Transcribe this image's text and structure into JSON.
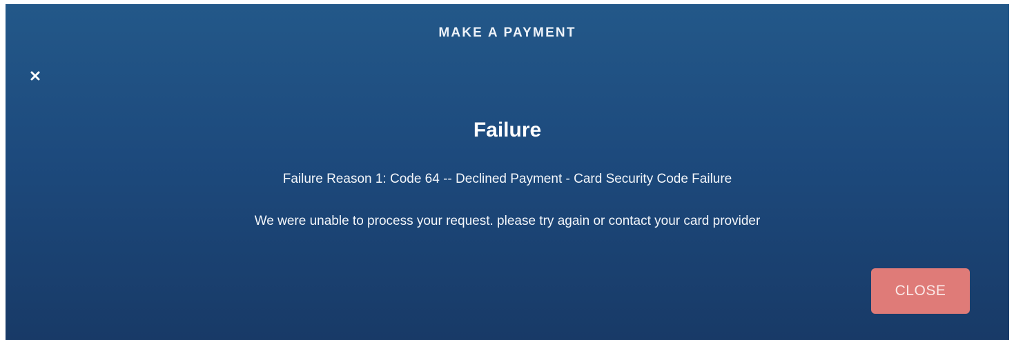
{
  "modal": {
    "title": "MAKE A PAYMENT",
    "close_icon": "close-icon",
    "headline": "Failure",
    "reason": "Failure Reason 1: Code 64 -- Declined Payment - Card Security Code Failure",
    "message": "We were unable to process your request. please try again or contact your card provider",
    "close_label": "CLOSE"
  },
  "colors": {
    "background_top": "#235889",
    "background_bottom": "#183a67",
    "close_button": "#df7b78",
    "text": "#ffffff"
  }
}
